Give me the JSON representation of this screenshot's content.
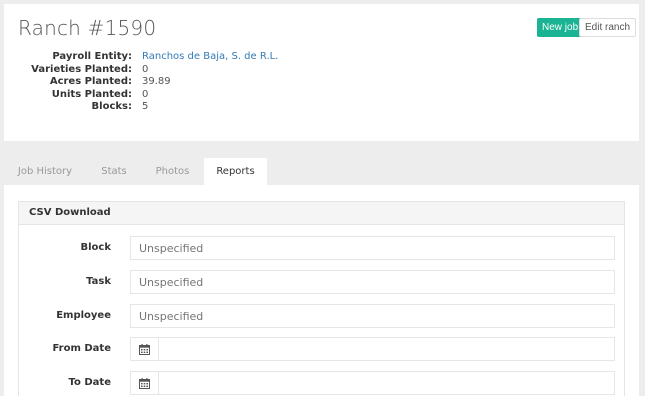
{
  "header": {
    "title": "Ranch #1590",
    "new_job_label": "New job",
    "edit_ranch_label": "Edit ranch",
    "accent_color": "#1ab394",
    "details": [
      {
        "label": "Payroll Entity:",
        "value": "Ranchos de Baja, S. de R.L."
      },
      {
        "label": "Varieties Planted:",
        "value": "0"
      },
      {
        "label": "Acres Planted:",
        "value": "39.89"
      },
      {
        "label": "Units Planted:",
        "value": "0"
      },
      {
        "label": "Blocks:",
        "value": "5"
      }
    ]
  },
  "tabs": [
    {
      "label": "Job History"
    },
    {
      "label": "Stats"
    },
    {
      "label": "Photos"
    },
    {
      "label": "Reports",
      "active": true
    }
  ],
  "csv_panel": {
    "title": "CSV Download",
    "fields": [
      {
        "label": "Block",
        "placeholder": "Unspecified"
      },
      {
        "label": "Task",
        "placeholder": "Unspecified"
      },
      {
        "label": "Employee",
        "placeholder": "Unspecified"
      },
      {
        "label": "From Date",
        "icon": "calendar-icon"
      },
      {
        "label": "To Date",
        "icon": "calendar-icon"
      }
    ]
  }
}
